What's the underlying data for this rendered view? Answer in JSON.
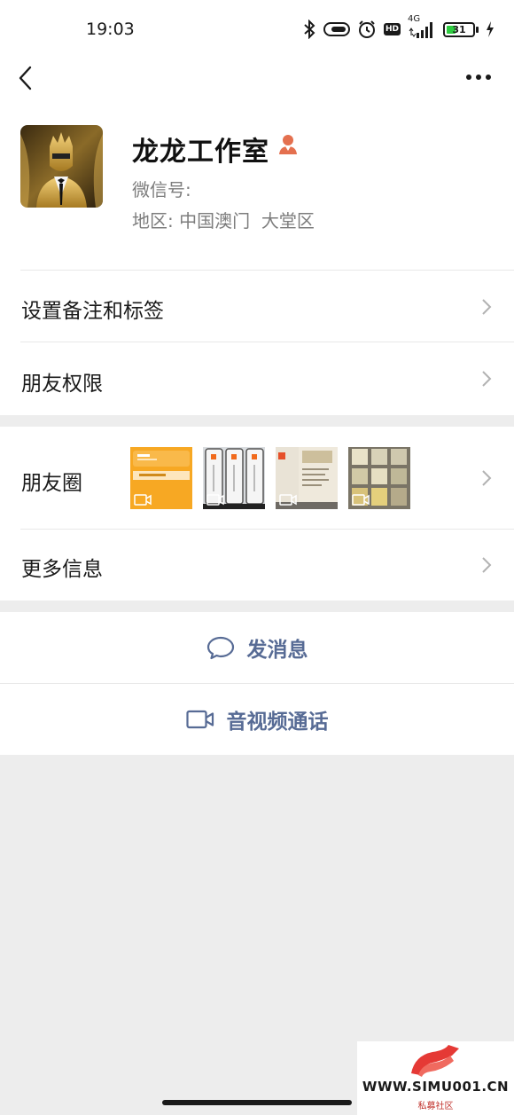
{
  "status_bar": {
    "time": "19:03",
    "network": "4G",
    "hd": "HD",
    "battery_level": "31",
    "icons": [
      "bluetooth-icon",
      "vibrate-icon",
      "alarm-icon",
      "hd-icon",
      "signal-icon",
      "battery-icon",
      "charging-icon"
    ]
  },
  "nav": {
    "back_icon": "back-arrow-icon",
    "more_icon": "more-dots-icon"
  },
  "profile": {
    "nickname": "龙龙工作室",
    "wechat_id_label": "微信号:",
    "wechat_id_value": "",
    "region_label": "地区:",
    "region_value": "中国澳门  大堂区",
    "gender_icon": "female-icon"
  },
  "menu": {
    "remark_tags": "设置备注和标签",
    "friend_permissions": "朋友权限",
    "moments": "朋友圈",
    "more_info": "更多信息"
  },
  "moments_thumbs": [
    {
      "kind": "video",
      "style": "orange-card",
      "texts": [
        "5:30 分",
        "首页提示",
        "蓝银行 9:07"
      ]
    },
    {
      "kind": "video",
      "style": "phones",
      "texts": []
    },
    {
      "kind": "video",
      "style": "document",
      "texts": []
    },
    {
      "kind": "video",
      "style": "screens",
      "texts": []
    }
  ],
  "actions": {
    "send_message": "发消息",
    "av_call": "音视频通话"
  },
  "watermark": {
    "url": "WWW.SIMU001.CN",
    "subtitle": "私募社区"
  },
  "colors": {
    "accent_blue": "#576b95",
    "background": "#ededed",
    "gender_icon": "#e4704f",
    "battery_green": "#2ecc40"
  }
}
